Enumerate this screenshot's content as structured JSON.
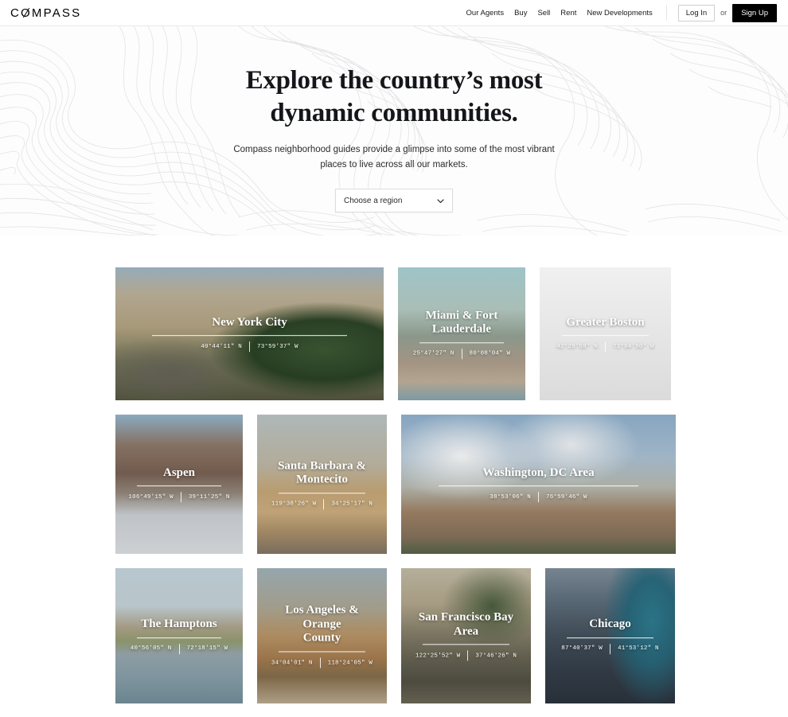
{
  "header": {
    "logo": "COMPASS",
    "nav_links": [
      {
        "label": "Our Agents"
      },
      {
        "label": "Buy"
      },
      {
        "label": "Sell"
      },
      {
        "label": "Rent"
      },
      {
        "label": "New Developments"
      }
    ],
    "login_label": "Log In",
    "or_label": "or",
    "signup_label": "Sign Up"
  },
  "hero": {
    "title_line1": "Explore the country’s most",
    "title_line2": "dynamic communities.",
    "subtitle_line1": "Compass neighborhood guides provide a glimpse into some of the most vibrant",
    "subtitle_line2": "places to live across all our markets.",
    "region_select_value": "Choose a region"
  },
  "grid": {
    "rows": [
      {
        "cards": [
          {
            "name": "New York City",
            "name_line2": "",
            "coord1": "40°44′11″ N",
            "coord2": "73°59′37″ W",
            "accent": "#b6a98a"
          },
          {
            "name": "Miami & Fort",
            "name_line2": "Lauderdale",
            "coord1": "25°47′27″ N",
            "coord2": "80°08′04″ W",
            "accent": "#8fa8a8"
          },
          {
            "name": "Greater Boston",
            "name_line2": "",
            "coord1": "42°20′58″ N",
            "coord2": "71°04′50″ W",
            "accent": "#c3a86a"
          }
        ]
      },
      {
        "cards": [
          {
            "name": "Aspen",
            "name_line2": "",
            "coord1": "106°49′15″ W",
            "coord2": "39°11′25″ N",
            "accent": "#8d7566"
          },
          {
            "name": "Santa Barbara &",
            "name_line2": "Montecito",
            "coord1": "119°38′26″ W",
            "coord2": "34°25′17″ N",
            "accent": "#c8a878"
          },
          {
            "name": "Washington, DC Area",
            "name_line2": "",
            "coord1": "38°53′06″ N",
            "coord2": "76°59′46″ W",
            "accent": "#9fb4c9"
          }
        ]
      },
      {
        "cards": [
          {
            "name": "The Hamptons",
            "name_line2": "",
            "coord1": "40°56′05″ N",
            "coord2": "72°18′15″ W",
            "accent": "#9fb6bd"
          },
          {
            "name": "Los Angeles & Orange",
            "name_line2": "County",
            "coord1": "34°04′01″ N",
            "coord2": "118°24′05″ W",
            "accent": "#c09a6b"
          },
          {
            "name": "San Francisco Bay Area",
            "name_line2": "",
            "coord1": "122°25′52″ W",
            "coord2": "37°46′26″ N",
            "accent": "#b0a183"
          },
          {
            "name": "Chicago",
            "name_line2": "",
            "coord1": "87°40′37″ W",
            "coord2": "41°53′12″ N",
            "accent": "#5f7f90"
          }
        ]
      }
    ]
  }
}
